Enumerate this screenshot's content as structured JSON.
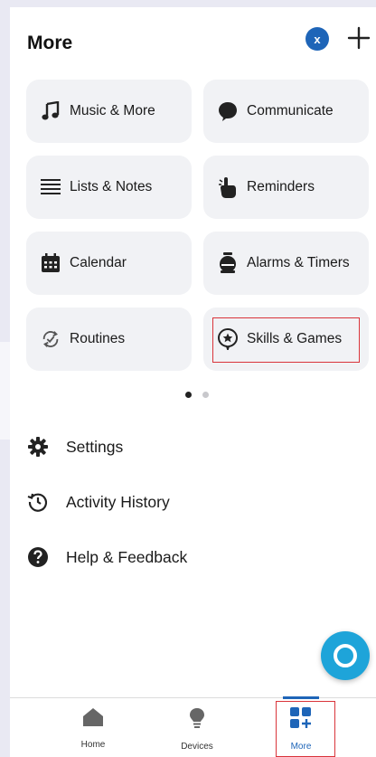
{
  "header": {
    "title": "More",
    "avatar_initial": "x"
  },
  "tiles": [
    {
      "label": "Music & More",
      "icon": "music-note-icon"
    },
    {
      "label": "Communicate",
      "icon": "chat-bubble-icon"
    },
    {
      "label": "Lists & Notes",
      "icon": "list-icon"
    },
    {
      "label": "Reminders",
      "icon": "hand-pointer-icon"
    },
    {
      "label": "Calendar",
      "icon": "calendar-icon"
    },
    {
      "label": "Alarms & Timers",
      "icon": "alarm-clock-icon"
    },
    {
      "label": "Routines",
      "icon": "routines-icon"
    },
    {
      "label": "Skills & Games",
      "icon": "skills-icon"
    }
  ],
  "pagination": {
    "total": 2,
    "active": 1
  },
  "menu": [
    {
      "label": "Settings",
      "icon": "gear-icon"
    },
    {
      "label": "Activity History",
      "icon": "history-icon"
    },
    {
      "label": "Help & Feedback",
      "icon": "help-icon"
    }
  ],
  "nav": [
    {
      "label": "Home",
      "icon": "home-icon"
    },
    {
      "label": "Devices",
      "icon": "lightbulb-icon"
    },
    {
      "label": "More",
      "icon": "more-grid-icon",
      "active": true
    }
  ],
  "colors": {
    "accent": "#1e65b8",
    "highlight": "#d9343a",
    "fab": "#1ea4d9",
    "tile_bg": "#f1f2f5"
  }
}
